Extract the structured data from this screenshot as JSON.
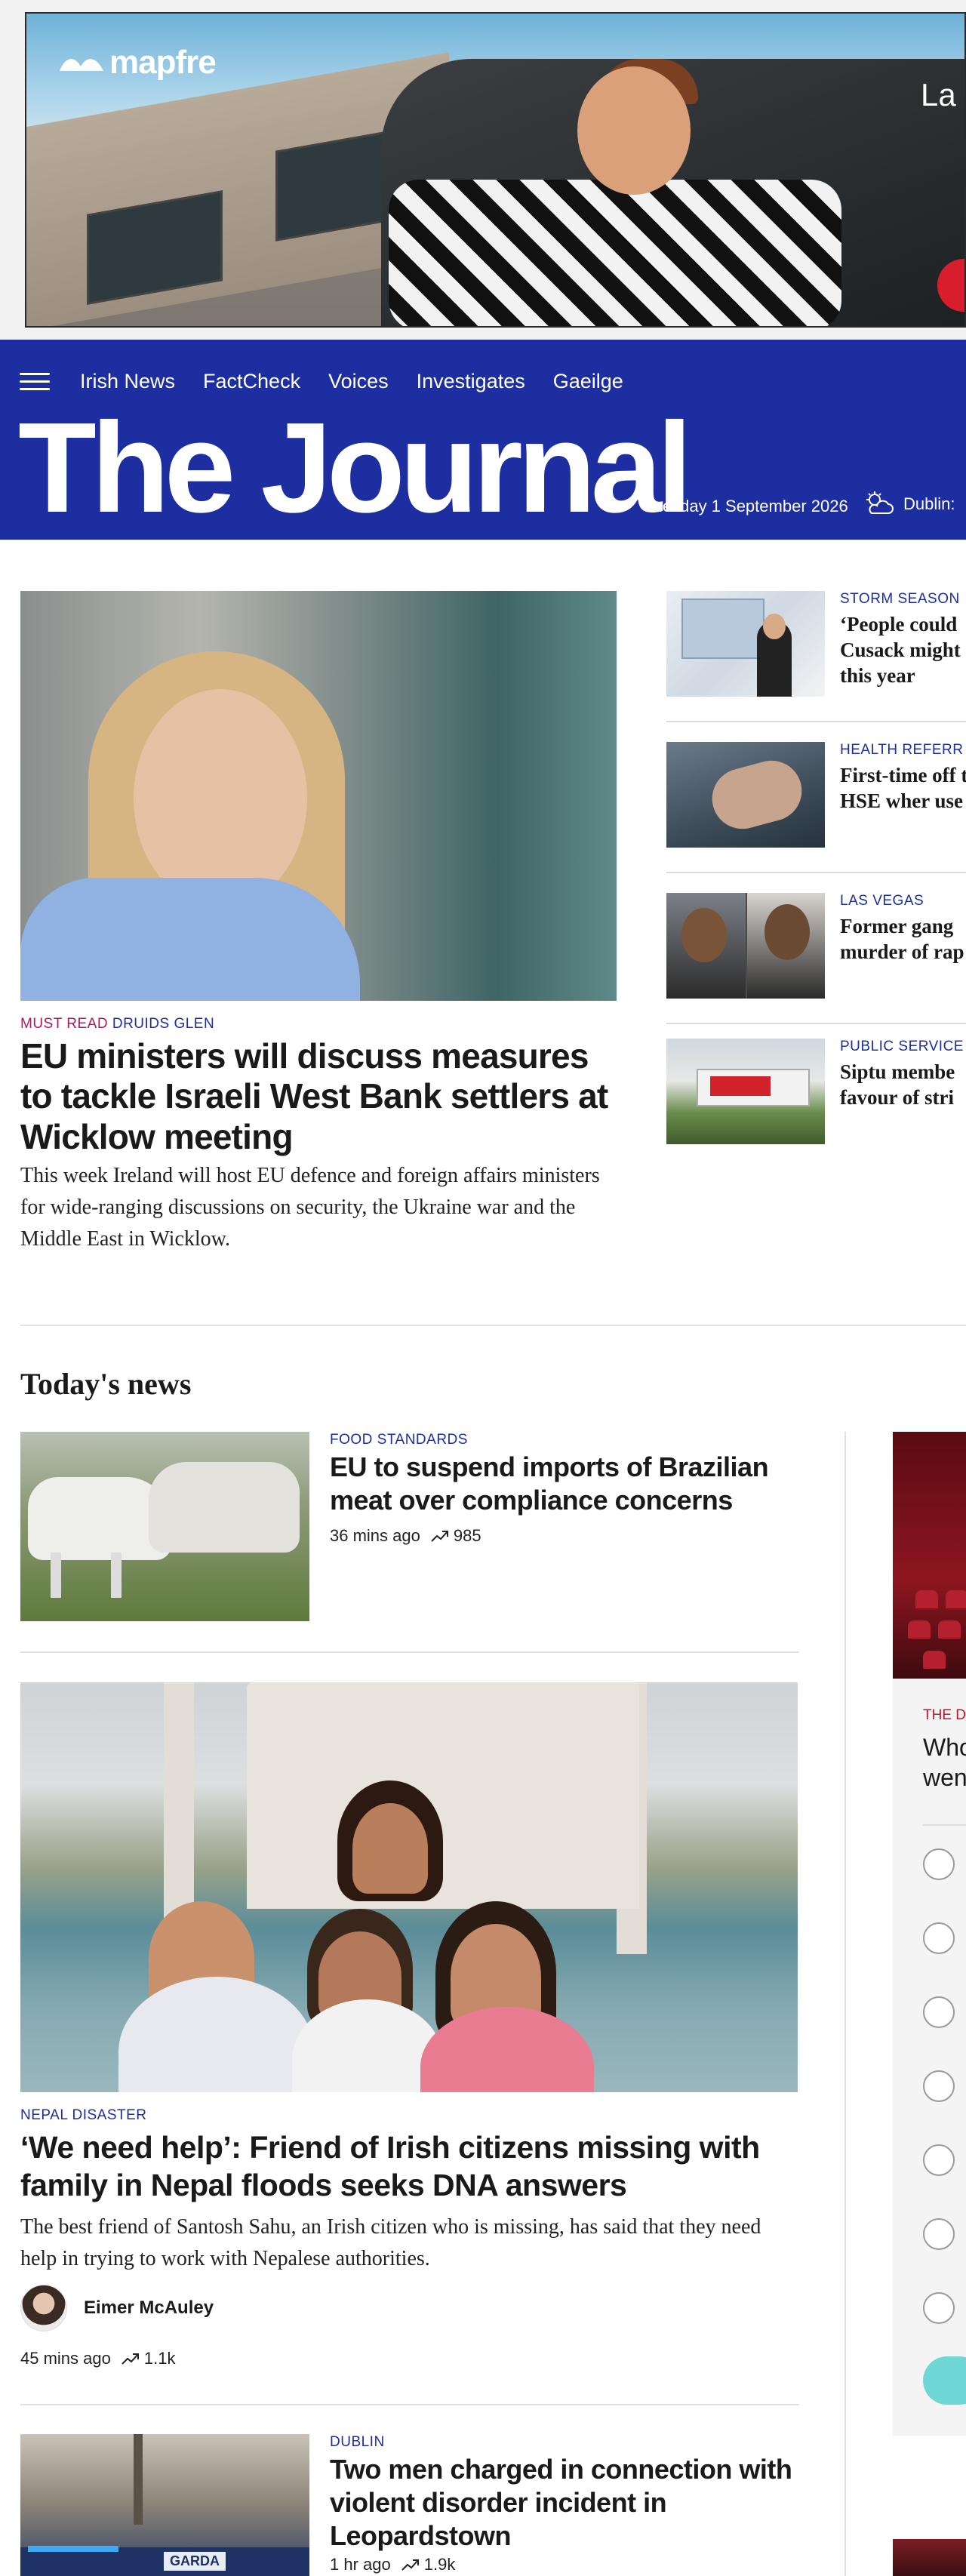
{
  "ad": {
    "brand": "mapfre",
    "tagline": "La",
    "colors": {
      "brand_red": "#d81e2c"
    }
  },
  "header": {
    "nav": [
      "Irish News",
      "FactCheck",
      "Voices",
      "Investigates",
      "Gaeilge"
    ],
    "brand": "The Journal",
    "date": "Tuesday 1 September 2026",
    "weather_label": "Dublin:",
    "colors": {
      "background": "#1d2ea0"
    }
  },
  "hero": {
    "kicker_must": "MUST READ",
    "kicker_place": "DRUIDS GLEN",
    "title": "EU ministers will discuss measures to tackle Israeli West Bank settlers at Wicklow meeting",
    "description": "This week Ireland will host EU defence and foreign affairs ministers for wide-ranging discussions on security, the Ukraine war and the Middle East in Wicklow."
  },
  "side_stories": [
    {
      "category": "STORM SEASON",
      "title": "‘People could Cusack might this year"
    },
    {
      "category": "HEALTH REFERR",
      "title": "First-time off the HSE wher use"
    },
    {
      "category": "LAS VEGAS",
      "title": "Former gang murder of rap"
    },
    {
      "category": "PUBLIC SERVICE",
      "title": "Siptu membe favour of stri"
    }
  ],
  "todays_news": {
    "heading": "Today's news",
    "stories": [
      {
        "category": "FOOD STANDARDS",
        "title": "EU to suspend imports of Brazilian meat over compliance concerns",
        "time": "36 mins ago",
        "views": "985"
      },
      {
        "category": "NEPAL DISASTER",
        "title": "‘We need help’: Friend of Irish citizens missing with family in Nepal floods seeks DNA answers",
        "description": "The best friend of Santosh Sahu, an Irish citizen who is missing, has said that they need help in trying to work with Nepalese authorities.",
        "author": "Eimer McAuley",
        "time": "45 mins ago",
        "views": "1.1k"
      },
      {
        "category": "DUBLIN",
        "title": "Two men charged in connection with violent disorder incident in Leopardstown",
        "time": "1 hr ago",
        "views": "1.9k"
      }
    ]
  },
  "promo": {
    "category": "THE D",
    "question_line1": "Who",
    "question_line2": "wen"
  },
  "icons": {
    "menu": "hamburger-icon",
    "weather": "partly-cloudy-icon",
    "trend": "trending-up-icon"
  }
}
